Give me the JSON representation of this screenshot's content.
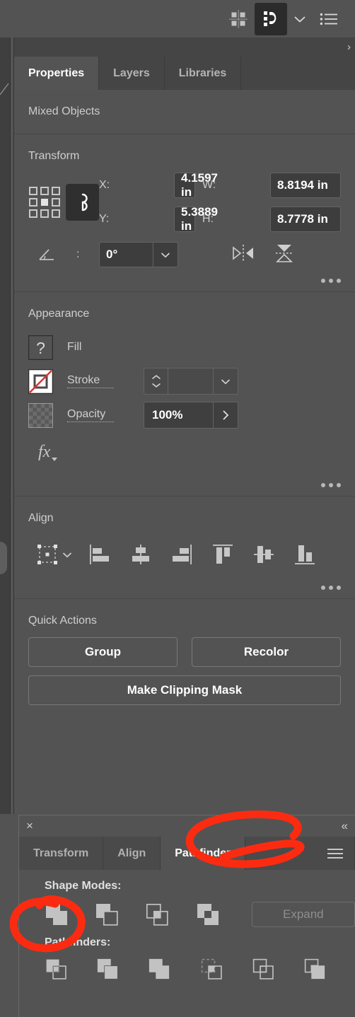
{
  "appbar": {
    "icons": [
      {
        "name": "arrange-documents-icon",
        "label": "Arrange Documents"
      },
      {
        "name": "properties-workspace-icon",
        "label": "Essentials"
      },
      {
        "name": "chevron-down-icon",
        "label": "Workspace Switcher"
      },
      {
        "name": "menu-list-icon",
        "label": "Menu"
      }
    ]
  },
  "panel": {
    "scroll_arrow": "›",
    "tabs": [
      {
        "label": "Properties",
        "active": true
      },
      {
        "label": "Layers",
        "active": false
      },
      {
        "label": "Libraries",
        "active": false
      }
    ],
    "selection_status": "Mixed Objects"
  },
  "transform": {
    "title": "Transform",
    "reference_point_icon": "reference-point-grid-icon",
    "fields": [
      {
        "label": "X:",
        "value": "4.1597 in"
      },
      {
        "label": "W:",
        "value": "8.8194 in"
      },
      {
        "label": "Y:",
        "value": "5.3889 in"
      },
      {
        "label": "H:",
        "value": "8.7778 in"
      }
    ],
    "x_label": "X:",
    "x_value": "4.1597 in",
    "w_label": "W:",
    "w_value": "8.8194 in",
    "y_label": "Y:",
    "y_value": "5.3889 in",
    "h_label": "H:",
    "h_value": "8.7778 in",
    "link_icon": "link-chain-icon",
    "angle_label": ":",
    "angle_value": "0°",
    "flip_horizontal_icon": "flip-horizontal-icon",
    "flip_vertical_icon": "flip-vertical-icon",
    "more_options": "•••"
  },
  "appearance": {
    "title": "Appearance",
    "fill_label": "Fill",
    "fill_swatch": "question-mark-swatch",
    "stroke_label": "Stroke",
    "stroke_swatch": "none-stroke-swatch",
    "stroke_weight_value": "",
    "opacity_label": "Opacity",
    "opacity_swatch": "checkerboard-swatch",
    "opacity_value": "100%",
    "fx_label": "fx",
    "more_options": "•••"
  },
  "align": {
    "title": "Align",
    "buttons": [
      {
        "name": "align-to-selection-dropdown",
        "label": "Align To"
      },
      {
        "name": "align-left-icon",
        "label": "Horizontal Align Left"
      },
      {
        "name": "align-horizontal-center-icon",
        "label": "Horizontal Align Center"
      },
      {
        "name": "align-right-icon",
        "label": "Horizontal Align Right"
      },
      {
        "name": "align-top-icon",
        "label": "Vertical Align Top"
      },
      {
        "name": "align-vertical-center-icon",
        "label": "Vertical Align Center"
      },
      {
        "name": "align-bottom-icon",
        "label": "Vertical Align Bottom"
      }
    ],
    "more_options": "•••"
  },
  "quick_actions": {
    "title": "Quick Actions",
    "group_label": "Group",
    "recolor_label": "Recolor",
    "clipping_mask_label": "Make Clipping Mask"
  },
  "pathfinder_panel": {
    "close_icon": "close-icon",
    "collapse_icon": "collapse-double-chevron-icon",
    "collapse_glyph": "«",
    "close_glyph": "×",
    "menu_icon": "panel-menu-icon",
    "tabs": [
      {
        "label": "Transform",
        "active": false
      },
      {
        "label": "Align",
        "active": false
      },
      {
        "label": "Pathfinder",
        "active": true
      }
    ],
    "shape_modes_label": "Shape Modes:",
    "shape_modes": [
      {
        "name": "unite-icon",
        "label": "Unite"
      },
      {
        "name": "minus-front-icon",
        "label": "Minus Front"
      },
      {
        "name": "intersect-icon",
        "label": "Intersect"
      },
      {
        "name": "exclude-icon",
        "label": "Exclude"
      }
    ],
    "expand_label": "Expand",
    "pathfinders_label": "Pathfinders:",
    "pathfinders": [
      {
        "name": "divide-icon",
        "label": "Divide"
      },
      {
        "name": "trim-icon",
        "label": "Trim"
      },
      {
        "name": "merge-icon",
        "label": "Merge"
      },
      {
        "name": "crop-icon",
        "label": "Crop"
      },
      {
        "name": "outline-icon",
        "label": "Outline"
      },
      {
        "name": "minus-back-icon",
        "label": "Minus Back"
      }
    ]
  },
  "annotations": {
    "color": "#FB2B11",
    "marks": [
      {
        "name": "pathfinder-tab-circle-annotation",
        "shape": "ellipse"
      },
      {
        "name": "unite-button-circle-annotation",
        "shape": "ellipse"
      }
    ]
  },
  "colors": {
    "panel_bg": "#535353",
    "tabbar_bg": "#454545",
    "field_bg": "#3d3d3d",
    "accent_red": "#FB2B11",
    "text_primary": "#ffffff",
    "text_secondary": "#cccccc"
  }
}
